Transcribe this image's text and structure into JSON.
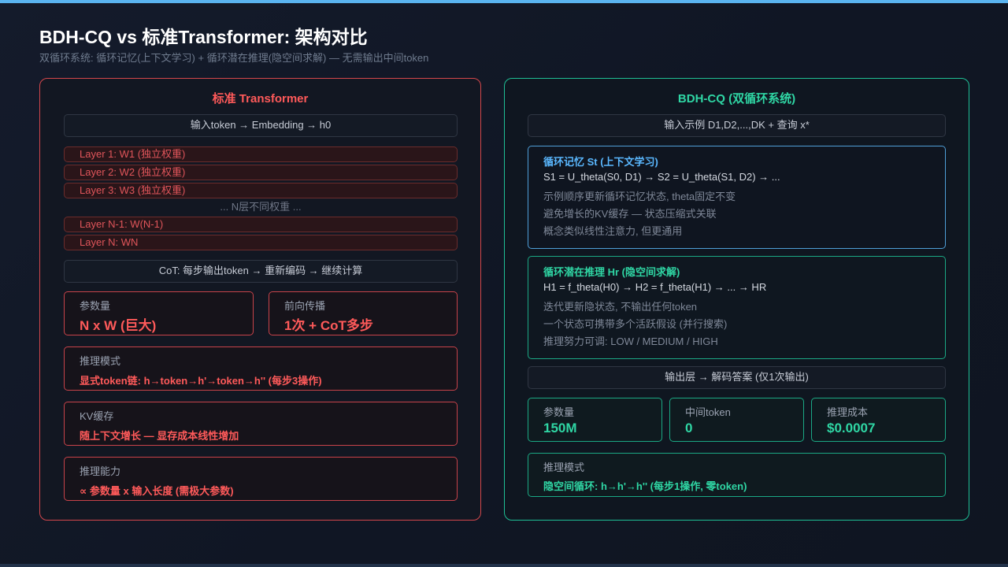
{
  "header": {
    "title": "BDH-CQ vs 标准Transformer: 架构对比",
    "subtitle": "双循环系统: 循环记忆(上下文学习) + 循环潜在推理(隐空间求解) — 无需输出中间token"
  },
  "left": {
    "title": "标准 Transformer",
    "input": "输入token → Embedding → h0",
    "layers": [
      "Layer 1: W1 (独立权重)",
      "Layer 2: W2 (独立权重)",
      "Layer 3: W3 (独立权重)"
    ],
    "layers_dots": "... N层不同权重 ...",
    "layers_tail": [
      "Layer N-1: W(N-1)",
      "Layer N: WN"
    ],
    "cot": "CoT: 每步输出token → 重新编码 → 继续计算",
    "stats": [
      {
        "label": "参数量",
        "value": "N x W (巨大)"
      },
      {
        "label": "前向传播",
        "value": "1次 + CoT多步"
      }
    ],
    "info": [
      {
        "label": "推理模式",
        "value": "显式token链: h→token→h'→token→h'' (每步3操作)"
      },
      {
        "label": "KV缓存",
        "value": "随上下文增长 — 显存成本线性增加"
      },
      {
        "label": "推理能力",
        "value": "∝ 参数量 x 输入长度 (需极大参数)"
      }
    ]
  },
  "right": {
    "title": "BDH-CQ (双循环系统)",
    "input": "输入示例 D1,D2,...,DK + 查询 x*",
    "memory": {
      "title": "循环记忆 St (上下文学习)",
      "formula": "S1 = U_theta(S0, D1) → S2 = U_theta(S1, D2) → ...",
      "notes": [
        "示例顺序更新循环记忆状态, theta固定不变",
        "避免增长的KV缓存 — 状态压缩式关联",
        "概念类似线性注意力, 但更通用"
      ]
    },
    "reasoning": {
      "title": "循环潜在推理 Hr (隐空间求解)",
      "formula": "H1 = f_theta(H0) → H2 = f_theta(H1) → ... → HR",
      "notes": [
        "迭代更新隐状态, 不输出任何token",
        "一个状态可携带多个活跃假设 (并行搜索)",
        "推理努力可调: LOW / MEDIUM / HIGH"
      ]
    },
    "output": "输出层 → 解码答案 (仅1次输出)",
    "stats": [
      {
        "label": "参数量",
        "value": "150M"
      },
      {
        "label": "中间token",
        "value": "0"
      },
      {
        "label": "推理成本",
        "value": "$0.0007"
      }
    ],
    "mode": {
      "label": "推理模式",
      "value": "隐空间循环: h→h'→h'' (每步1操作, 零token)"
    }
  },
  "colors": {
    "accent_red": "#ff5a5a",
    "accent_green": "#2fd6a4",
    "accent_blue": "#5ab8ff",
    "background": "#121826"
  }
}
